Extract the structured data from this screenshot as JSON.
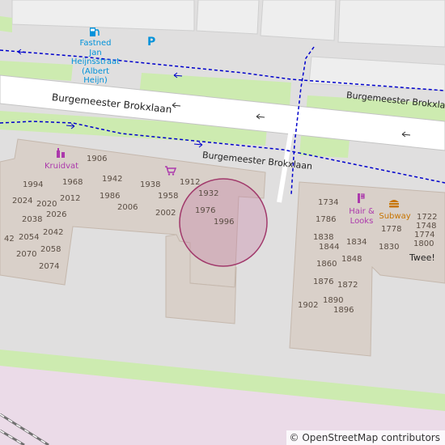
{
  "map": {
    "streets": {
      "street_upper": "Burgemeester Brokxlaan",
      "street_lower": "Burgemeester Brokxlaan"
    },
    "pois": {
      "fuel_name": "Fastned\nJan Heijnsstraat\n(Albert\nHeijn)",
      "parking_symbol": "P",
      "kruidvat": "Kruidvat",
      "hair_looks": "Hair &\nLooks",
      "subway": "Subway",
      "twee": "Twee!"
    },
    "house_numbers": [
      "1906",
      "1994",
      "1968",
      "1942",
      "1938",
      "1912",
      "1932",
      "2024",
      "2020",
      "2012",
      "1986",
      "2006",
      "1958",
      "2002",
      "1976",
      "1996",
      "2038",
      "2026",
      "42",
      "2054",
      "2042",
      "2058",
      "2070",
      "2074",
      "1734",
      "1722",
      "1786",
      "1748",
      "1774",
      "1778",
      "1838",
      "1800",
      "1844",
      "1834",
      "1830",
      "1860",
      "1848",
      "1876",
      "1872",
      "1890",
      "1902",
      "1896"
    ],
    "attribution": "© OpenStreetMap contributors",
    "colors": {
      "background": "#e0dfdf",
      "building": "#d9d0c9",
      "grass": "#cdebb0",
      "road": "#ffffff",
      "path": "#0000cc",
      "highlight": "#c77fa3",
      "railway_area": "#ebdbe8",
      "shop_label": "#ac39ac",
      "fuel_label": "#0092da",
      "food_label": "#c77400"
    }
  }
}
